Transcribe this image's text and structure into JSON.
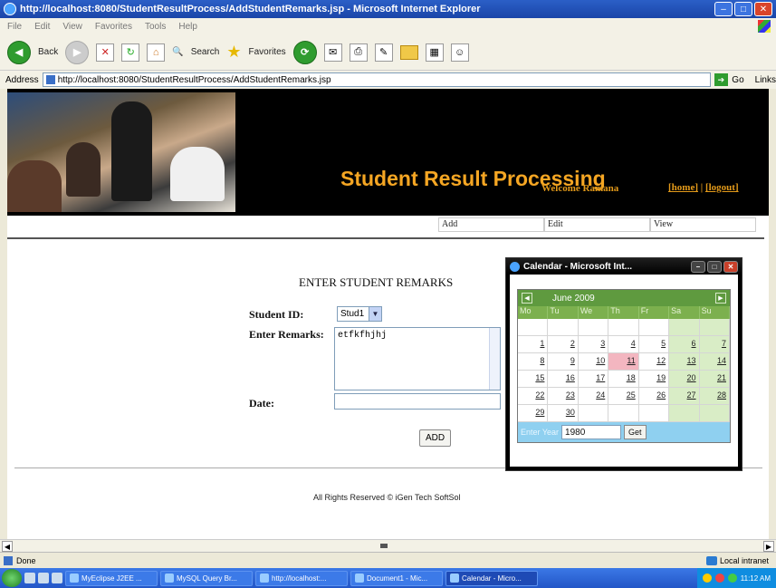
{
  "window": {
    "title": "http://localhost:8080/StudentResultProcess/AddStudentRemarks.jsp - Microsoft Internet Explorer"
  },
  "menu": [
    "File",
    "Edit",
    "View",
    "Favorites",
    "Tools",
    "Help"
  ],
  "toolbar": {
    "back_label": "Back",
    "search_label": "Search",
    "favorites_label": "Favorites"
  },
  "address": {
    "label": "Address",
    "url": "http://localhost:8080/StudentResultProcess/AddStudentRemarks.jsp",
    "go_label": "Go",
    "links_label": "Links"
  },
  "banner": {
    "site_title": "Student Result Processing",
    "welcome": "Welcome Ramana",
    "home_link": "[home]",
    "separator": "|",
    "logout_link": "[logout]"
  },
  "nav_menu": [
    "Add",
    "Edit",
    "View"
  ],
  "form": {
    "title": "ENTER STUDENT REMARKS",
    "student_id_label": "Student ID:",
    "student_id_value": "Stud1",
    "remarks_label": "Enter Remarks:",
    "remarks_value": "etfkfhjhj",
    "date_label": "Date:",
    "date_value": "",
    "add_button": "ADD"
  },
  "footer": "All Rights Reserved © iGen Tech SoftSol",
  "calendar_window": {
    "title": "Calendar - Microsoft Int...",
    "month_label": "June 2009",
    "prev_icon": "prev-month-icon",
    "next_icon": "next-month-icon",
    "weekdays": [
      "Mo",
      "Tu",
      "We",
      "Th",
      "Fr",
      "Sa",
      "Su"
    ],
    "weeks": [
      [
        "",
        "",
        "",
        "",
        "",
        "",
        ""
      ],
      [
        "1",
        "2",
        "3",
        "4",
        "5",
        "6",
        "7"
      ],
      [
        "8",
        "9",
        "10",
        "11",
        "12",
        "13",
        "14"
      ],
      [
        "15",
        "16",
        "17",
        "18",
        "19",
        "20",
        "21"
      ],
      [
        "22",
        "23",
        "24",
        "25",
        "26",
        "27",
        "28"
      ],
      [
        "29",
        "30",
        "",
        "",
        "",
        "",
        ""
      ]
    ],
    "highlighted_day": "11",
    "enter_year_label": "Enter Year",
    "year_value": "1980",
    "get_button": "Get",
    "colors": {
      "header": "#5f9a3f",
      "weekday_row": "#7cb04e",
      "weekend": "#d9edc6",
      "highlight": "#f3b6c0",
      "footer": "#8fd0f0"
    }
  },
  "status": {
    "text": "Done",
    "zone": "Local intranet"
  },
  "taskbar": {
    "items": [
      "MyEclipse J2EE ...",
      "MySQL Query Br...",
      "http://localhost:...",
      "Document1 - Mic...",
      "Calendar - Micro..."
    ],
    "active_index": 4,
    "clock": "11:12 AM"
  }
}
